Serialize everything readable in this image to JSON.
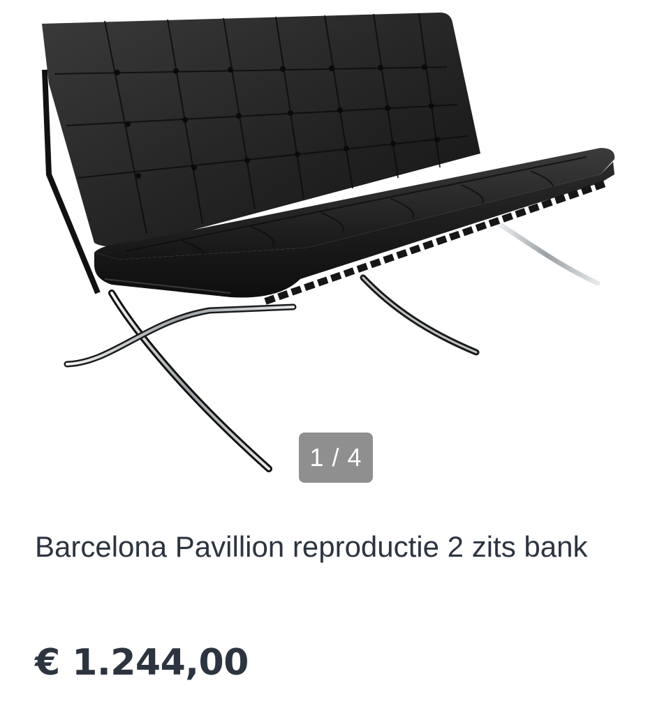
{
  "gallery": {
    "image_icon": "sofa-photo",
    "counter": "1 / 4"
  },
  "product": {
    "title": "Barcelona Pavillion reproductie 2 zits bank",
    "price": "€ 1.244,00"
  },
  "colors": {
    "text": "#2c3440",
    "counter_bg": "#8f8f8f",
    "leather": "#1c1c1c",
    "chrome": "#d9dde0"
  }
}
